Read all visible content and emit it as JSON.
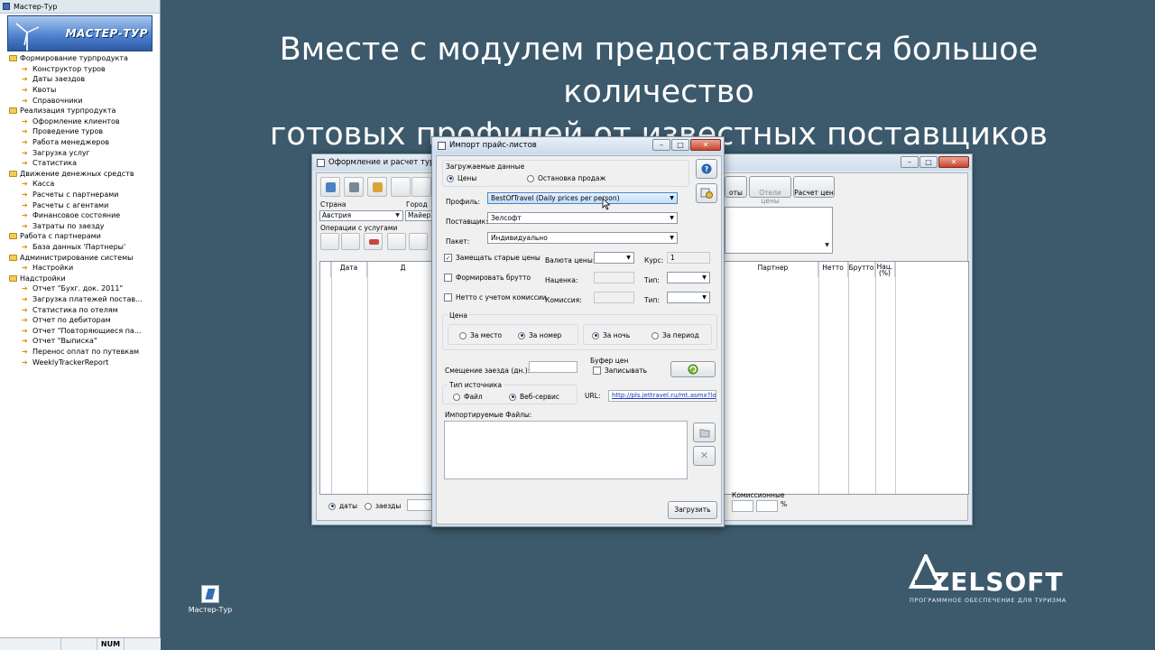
{
  "headline": {
    "line1": "Вместе с модулем предоставляется большое количество",
    "line2": "готовых профилей от известных поставщиков"
  },
  "nav": {
    "window_title": "Мастер-Тур",
    "logo_text": "МАСТЕР-ТУР",
    "groups": [
      {
        "label": "Формирование турпродукта",
        "items": [
          "Конструктор туров",
          "Даты заездов",
          "Квоты",
          "Справочники"
        ]
      },
      {
        "label": "Реализация турпродукта",
        "items": [
          "Оформление клиентов",
          "Проведение туров",
          "Работа менеджеров",
          "Загрузка услуг",
          "Статистика"
        ]
      },
      {
        "label": "Движение денежных средств",
        "items": [
          "Касса",
          "Расчеты с партнерами",
          "Расчеты с агентами",
          "Финансовое состояние",
          "Затраты по заезду"
        ]
      },
      {
        "label": "Работа с партнерами",
        "items": [
          "База данных 'Партнеры'"
        ]
      },
      {
        "label": "Администрирование системы",
        "items": [
          "Настройки"
        ]
      },
      {
        "label": "Надстройки",
        "items": [
          "Отчет \"Бухг. док. 2011\"",
          "Загрузка платежей постав...",
          "Статистика по отелям",
          "Отчет по дебиторам",
          "Отчет \"Повторяющиеся па...",
          "Отчет \"Выписка\"",
          "Перенос оплат по путевкам",
          "WeeklyTrackerReport"
        ]
      }
    ],
    "status_num": "NUM"
  },
  "desktop_icon": {
    "label": "Мастер-Тур"
  },
  "brand": {
    "name": "ZELSOFT",
    "tagline": "ПРОГРАММНОЕ ОБЕСПЕЧЕНИЕ ДЛЯ ТУРИЗМА"
  },
  "bg_window": {
    "title": "Оформление и расчет туров",
    "country_label": "Страна",
    "country_value": "Австрия",
    "city_label": "Город",
    "city_value": "Майерхо",
    "ops_label": "Операции с услугами",
    "btn_otels_partial": "оты",
    "btn_otels": "Отели цены",
    "btn_calc": "Расчет цен",
    "grid_headers_left": [
      "Дата",
      "Д"
    ],
    "grid_headers_right": [
      "Партнер",
      "Нетто",
      "Брутто",
      "Нац. (%)"
    ],
    "radio_dates": "даты",
    "radio_arrivals": "заезды",
    "commission_label": "Комиссионные",
    "percent": "%"
  },
  "modal": {
    "title": "Импорт прайс-листов",
    "loaded_data_label": "Загружаемые данные",
    "radio_prices": "Цены",
    "radio_stop": "Остановка продаж",
    "profile_label": "Профиль:",
    "profile_value": "BestOfTravel (Daily prices per person)",
    "supplier_label": "Поставщик:",
    "supplier_value": "Зелсофт",
    "package_label": "Пакет:",
    "package_value": "Индивидуально",
    "chk_replace": "Замещать старые цены",
    "chk_brutto": "Формировать брутто",
    "chk_netto": "Нетто с учетом комиссии",
    "currency_label": "Валюта цены:",
    "rate_label": "Курс:",
    "rate_value": "1",
    "markup_label": "Наценка:",
    "type1_label": "Тип:",
    "commission_label": "Комиссия:",
    "type2_label": "Тип:",
    "price_group": "Цена",
    "r_place": "За место",
    "r_room": "За номер",
    "r_night": "За ночь",
    "r_period": "За период",
    "shift_label": "Смещение заезда (дн.):",
    "buffer_label": "Буфер цен",
    "chk_write": "Записывать",
    "source_type_label": "Тип источника",
    "r_file": "Файл",
    "r_web": "Веб-сервис",
    "url_label": "URL:",
    "url_value": "http://pls.jettravel.ru/mt.asmx?login=",
    "files_label": "Импортируемые Файлы:",
    "load_button": "Загрузить"
  }
}
